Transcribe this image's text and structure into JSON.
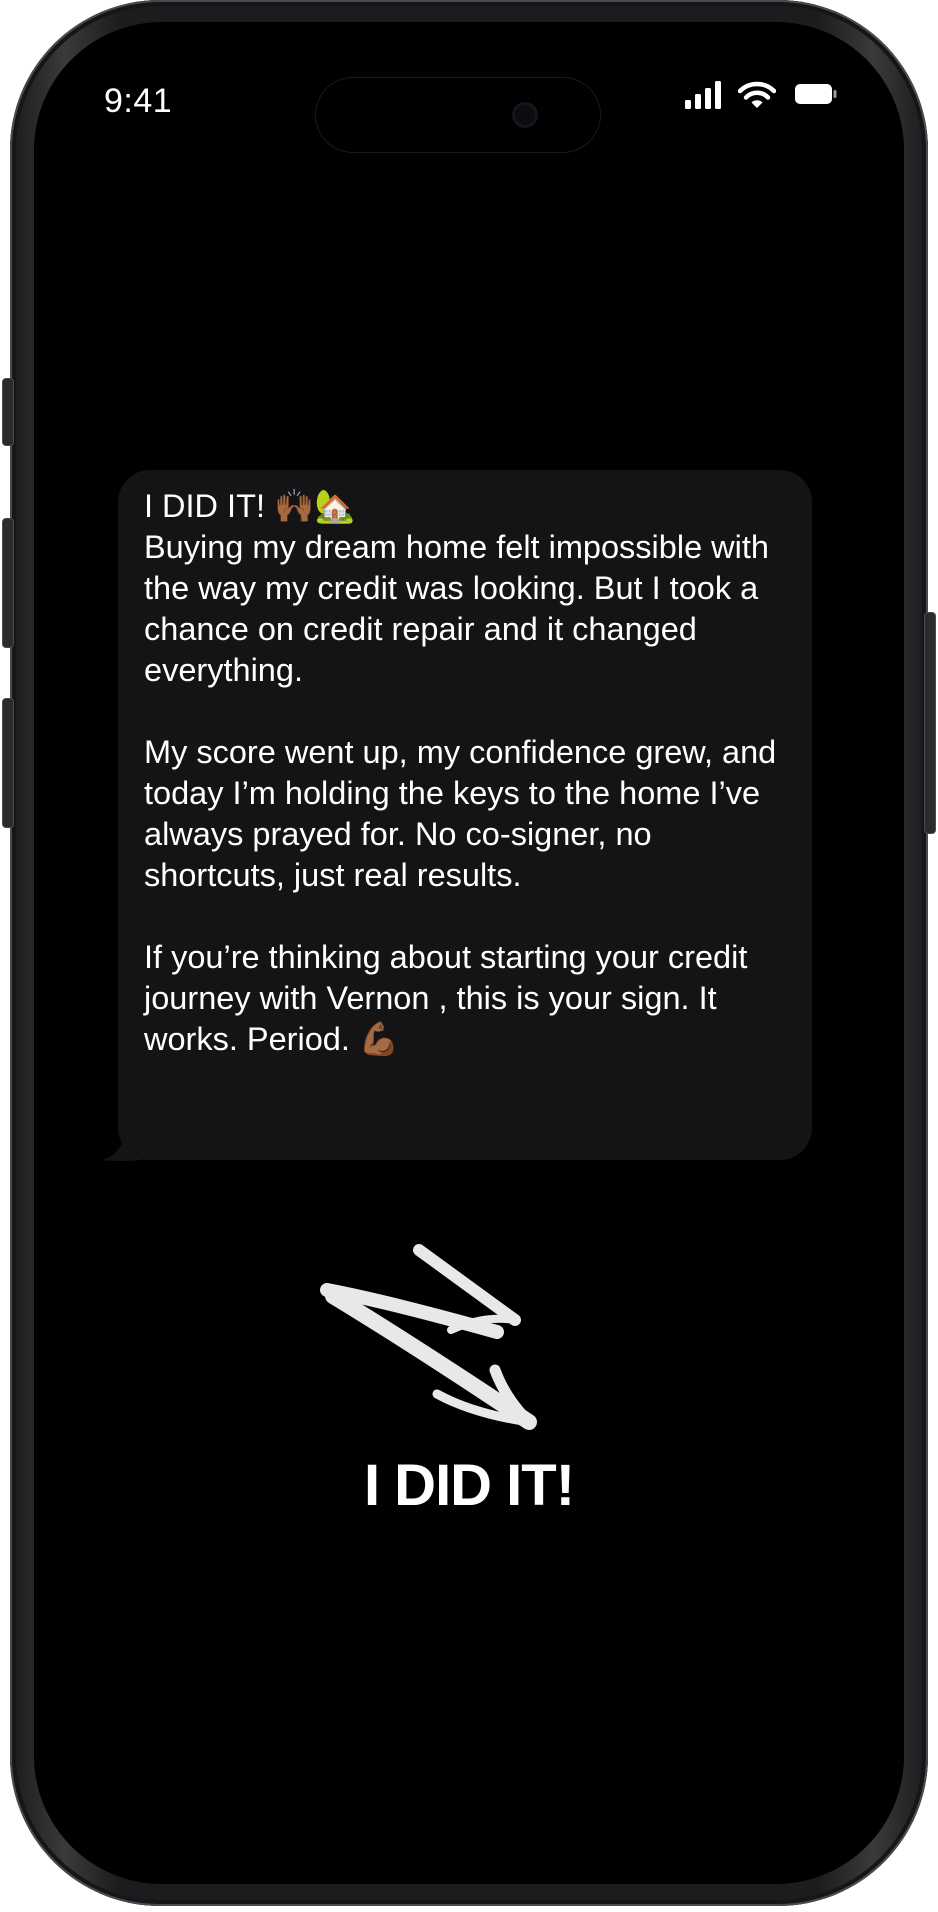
{
  "status_bar": {
    "time": "9:41",
    "icons": [
      "cellular-signal-icon",
      "wifi-icon",
      "battery-icon"
    ]
  },
  "message": {
    "text": "I DID IT! 🙌🏾🏡\nBuying my dream home felt impossible with the way my credit was looking. But I took a chance on credit repair and it changed everything.\n\nMy score went up, my confidence grew, and today I’m holding the keys to the home I’ve always prayed for. No co-signer, no shortcuts, just real results.\n\nIf you’re thinking about starting your credit journey with Vernon , this is your sign. It works. Period. 💪🏾"
  },
  "caption": "I DID IT!",
  "colors": {
    "screen_background": "#000000",
    "bubble_background": "#141416",
    "text": "#ffffff",
    "scribble": "#e8e8e8"
  }
}
